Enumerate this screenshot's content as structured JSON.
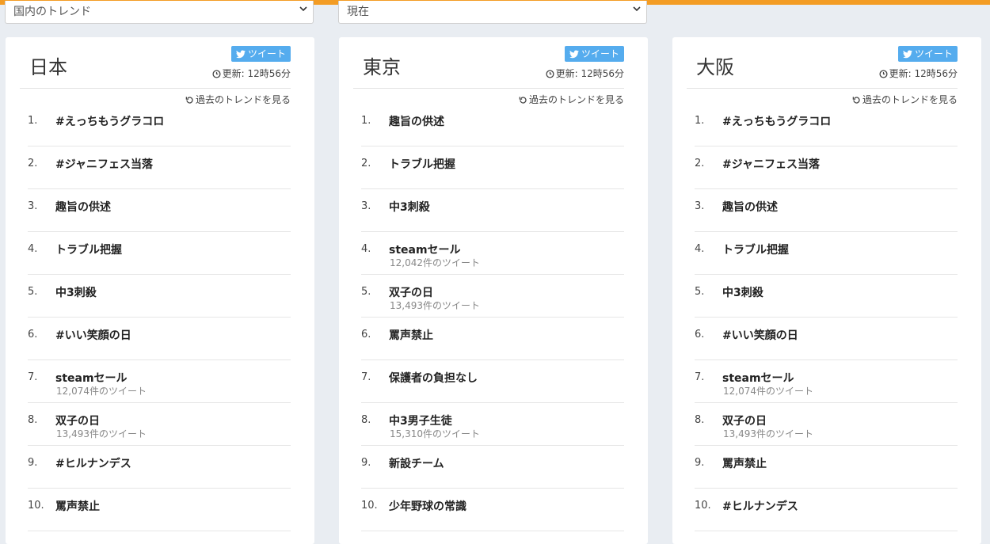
{
  "filters": {
    "region_select": "国内のトレンド",
    "time_select": "現在"
  },
  "common": {
    "tweet_label": "ツイート",
    "updated_label": "更新: 12時56分",
    "past_trends_label": "過去のトレンドを見る"
  },
  "panels": [
    {
      "title": "日本",
      "trends": [
        {
          "rank": "1.",
          "term": "#えっちもうグラコロ",
          "count": ""
        },
        {
          "rank": "2.",
          "term": "#ジャニフェス当落",
          "count": ""
        },
        {
          "rank": "3.",
          "term": "趣旨の供述",
          "count": ""
        },
        {
          "rank": "4.",
          "term": "トラブル把握",
          "count": ""
        },
        {
          "rank": "5.",
          "term": "中3刺殺",
          "count": ""
        },
        {
          "rank": "6.",
          "term": "#いい笑顔の日",
          "count": ""
        },
        {
          "rank": "7.",
          "term": "steamセール",
          "count": "12,074件のツイート"
        },
        {
          "rank": "8.",
          "term": "双子の日",
          "count": "13,493件のツイート"
        },
        {
          "rank": "9.",
          "term": "#ヒルナンデス",
          "count": ""
        },
        {
          "rank": "10.",
          "term": "罵声禁止",
          "count": ""
        }
      ]
    },
    {
      "title": "東京",
      "trends": [
        {
          "rank": "1.",
          "term": "趣旨の供述",
          "count": ""
        },
        {
          "rank": "2.",
          "term": "トラブル把握",
          "count": ""
        },
        {
          "rank": "3.",
          "term": "中3刺殺",
          "count": ""
        },
        {
          "rank": "4.",
          "term": "steamセール",
          "count": "12,042件のツイート"
        },
        {
          "rank": "5.",
          "term": "双子の日",
          "count": "13,493件のツイート"
        },
        {
          "rank": "6.",
          "term": "罵声禁止",
          "count": ""
        },
        {
          "rank": "7.",
          "term": "保護者の負担なし",
          "count": ""
        },
        {
          "rank": "8.",
          "term": "中3男子生徒",
          "count": "15,310件のツイート"
        },
        {
          "rank": "9.",
          "term": "新設チーム",
          "count": ""
        },
        {
          "rank": "10.",
          "term": "少年野球の常識",
          "count": ""
        }
      ]
    },
    {
      "title": "大阪",
      "trends": [
        {
          "rank": "1.",
          "term": "#えっちもうグラコロ",
          "count": ""
        },
        {
          "rank": "2.",
          "term": "#ジャニフェス当落",
          "count": ""
        },
        {
          "rank": "3.",
          "term": "趣旨の供述",
          "count": ""
        },
        {
          "rank": "4.",
          "term": "トラブル把握",
          "count": ""
        },
        {
          "rank": "5.",
          "term": "中3刺殺",
          "count": ""
        },
        {
          "rank": "6.",
          "term": "#いい笑顔の日",
          "count": ""
        },
        {
          "rank": "7.",
          "term": "steamセール",
          "count": "12,074件のツイート"
        },
        {
          "rank": "8.",
          "term": "双子の日",
          "count": "13,493件のツイート"
        },
        {
          "rank": "9.",
          "term": "罵声禁止",
          "count": ""
        },
        {
          "rank": "10.",
          "term": "#ヒルナンデス",
          "count": ""
        }
      ]
    }
  ]
}
